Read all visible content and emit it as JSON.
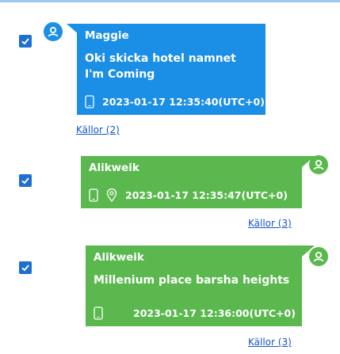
{
  "colors": {
    "incoming_bubble": "#1b8ee6",
    "outgoing_bubble": "#5ab84e",
    "checkbox": "#1f6fd1",
    "link": "#1a55c8"
  },
  "messages": [
    {
      "sender": "Maggie",
      "text": "Oki skicka hotel namnet I'm Coming",
      "timestamp": "2023-01-17 12:35:40(UTC+0)",
      "sources": "Källor (2)",
      "direction": "incoming",
      "checked": true,
      "icons": [
        "phone-icon"
      ]
    },
    {
      "sender": "Alikweik",
      "text": "",
      "timestamp": "2023-01-17 12:35:47(UTC+0)",
      "sources": "Källor (3)",
      "direction": "outgoing",
      "checked": true,
      "icons": [
        "phone-icon",
        "location-pin-icon"
      ]
    },
    {
      "sender": "Alikweik",
      "text": "Millenium place barsha heights",
      "timestamp": "2023-01-17 12:36:00(UTC+0)",
      "sources": "Källor (3)",
      "direction": "outgoing",
      "checked": true,
      "icons": [
        "phone-icon"
      ]
    }
  ]
}
